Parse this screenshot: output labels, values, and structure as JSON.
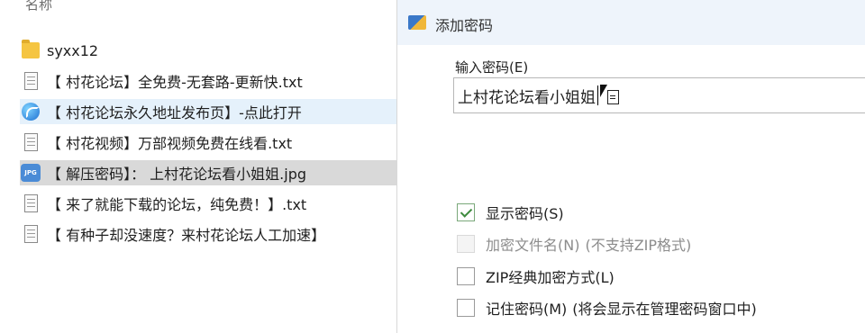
{
  "file_list": {
    "column_header": "名称",
    "items": [
      {
        "name": "syxx12",
        "icon": "folder-icon"
      },
      {
        "name": "【 村花论坛】全免费-无套路-更新快.txt",
        "icon": "text-file-icon"
      },
      {
        "name": "【 村花论坛永久地址发布页】-点此打开",
        "icon": "browser-link-icon"
      },
      {
        "name": "【 村花视频】万部视频免费在线看.txt",
        "icon": "text-file-icon"
      },
      {
        "name": "【 解压密码】： 上村花论坛看小姐姐.jpg",
        "icon": "jpg-file-icon"
      },
      {
        "name": "【 来了就能下载的论坛，纯免费！】.txt",
        "icon": "text-file-icon"
      },
      {
        "name": "【 有种子却没速度？来村花论坛人工加速】",
        "icon": "text-file-icon"
      }
    ],
    "jpg_badge": "JPG"
  },
  "dialog": {
    "title": "添加密码",
    "password_label": "输入密码(E)",
    "password_value": "上村花论坛看小姐姐",
    "options": [
      {
        "label": "显示密码(S)",
        "note": "",
        "checked": true,
        "disabled": false
      },
      {
        "label": "加密文件名(N)",
        "note": "(不支持ZIP格式)",
        "checked": false,
        "disabled": true
      },
      {
        "label": "ZIP经典加密方式(L)",
        "note": "",
        "checked": false,
        "disabled": false
      },
      {
        "label": "记住密码(M)",
        "note": "(将会显示在管理密码窗口中)",
        "checked": false,
        "disabled": false
      }
    ]
  },
  "colors": {
    "hover_row": "#e5f1fb",
    "selected_row": "#d9d9d9",
    "titlebar": "#eef4fb",
    "check_mark": "#3e8b3e"
  }
}
